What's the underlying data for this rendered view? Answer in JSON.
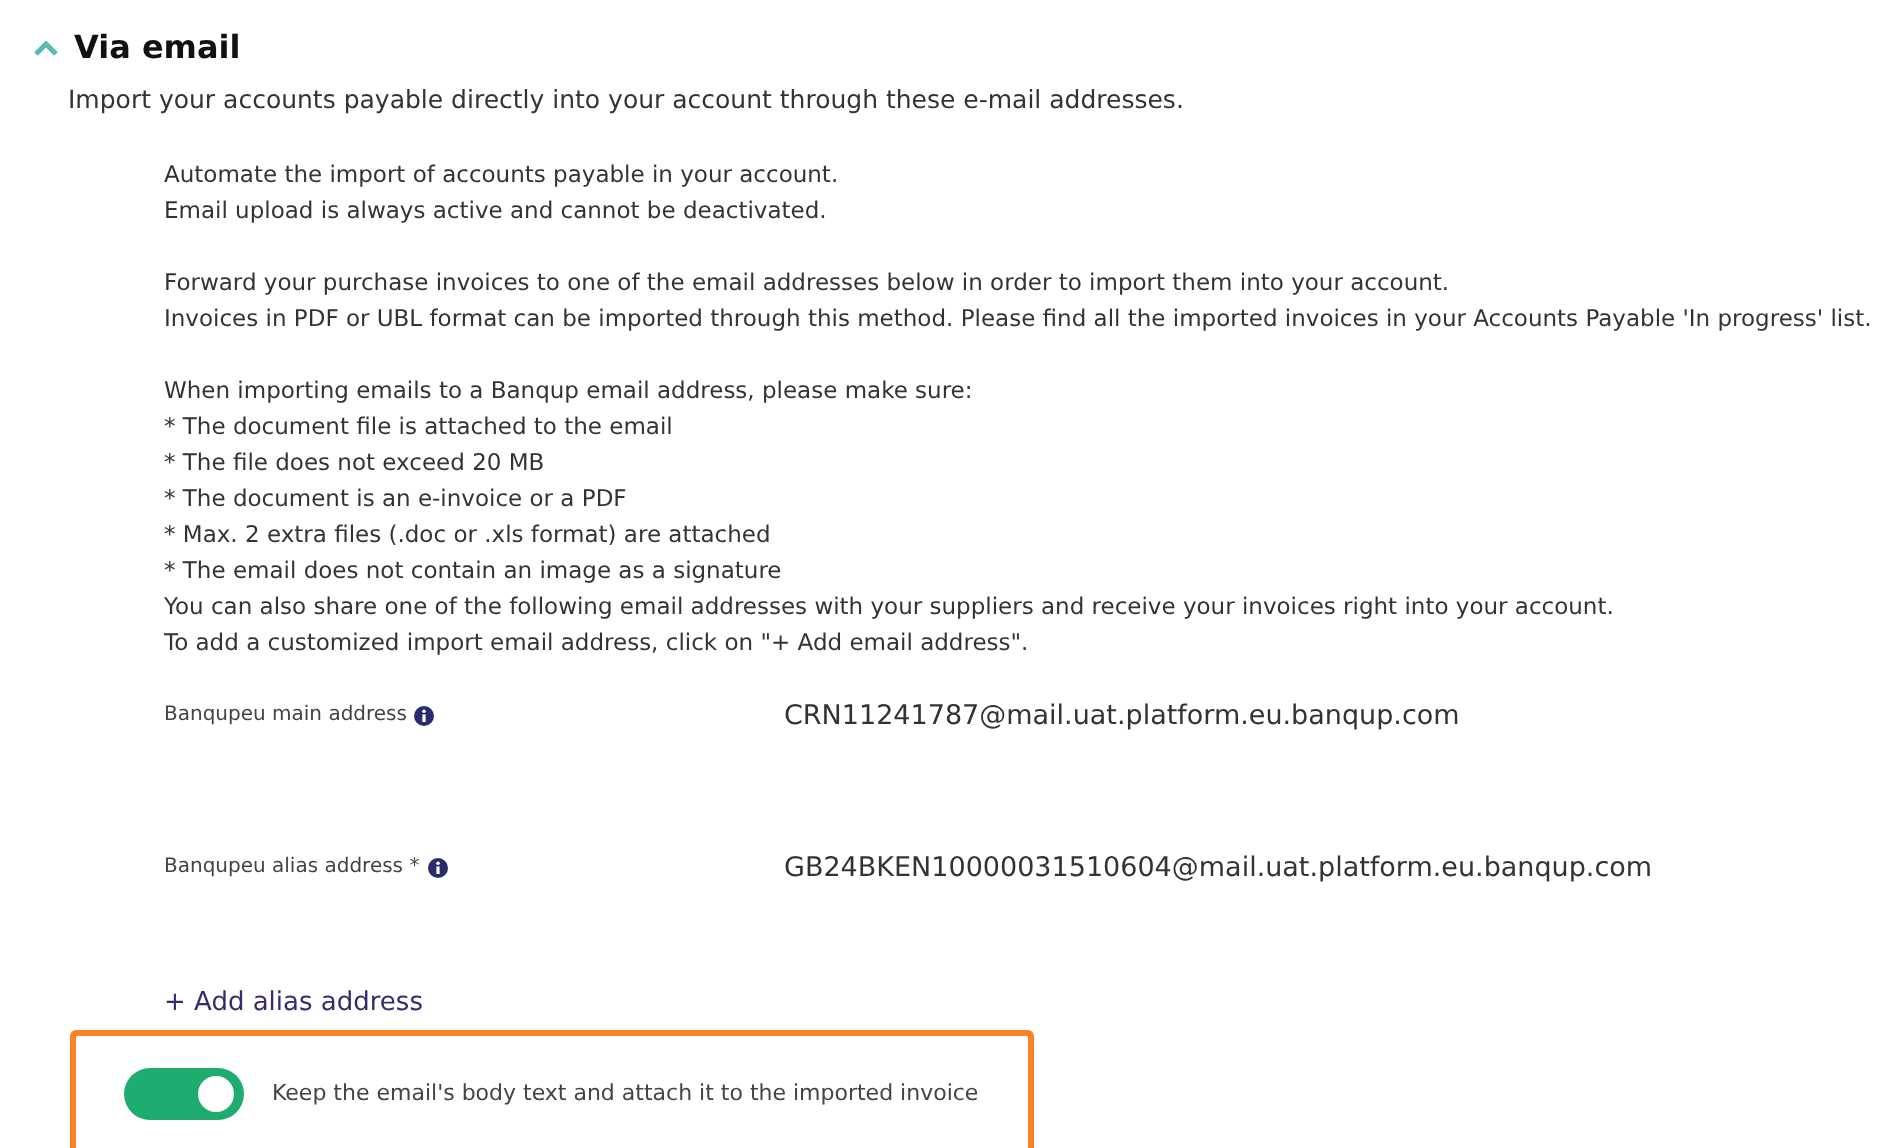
{
  "section": {
    "title": "Via email",
    "expanded": true,
    "subtitle": "Import your accounts payable directly into your account through these e-mail addresses."
  },
  "paragraphs": [
    [
      "Automate the import of accounts payable in your account.",
      "Email upload is always active and cannot be deactivated."
    ],
    [
      "Forward your purchase invoices to one of the email addresses below in order to import them into your account.",
      "Invoices in PDF or UBL format can be imported through this method. Please find all the imported invoices in your Accounts Payable 'In progress' list."
    ],
    [
      "When importing emails to a Banqup email address, please make sure:",
      "* The document file is attached to the email",
      "* The file does not exceed 20 MB",
      "* The document is an e-invoice or a PDF",
      "* Max. 2 extra files (.doc or .xls format) are attached",
      "* The email does not contain an image as a signature",
      "You can also share one of the following email addresses with your suppliers and receive your invoices right into your account.",
      "To add a customized import email address, click on \"+ Add email address\"."
    ]
  ],
  "addresses": [
    {
      "label": "Banqupeu main address",
      "value": "CRN11241787@mail.uat.platform.eu.banqup.com"
    },
    {
      "label": "Banqupeu alias address *",
      "value": "GB24BKEN10000031510604@mail.uat.platform.eu.banqup.com"
    }
  ],
  "add_link": "+ Add alias address",
  "toggle": {
    "label": "Keep the email's body text and attach it to the imported invoice",
    "on": true
  }
}
